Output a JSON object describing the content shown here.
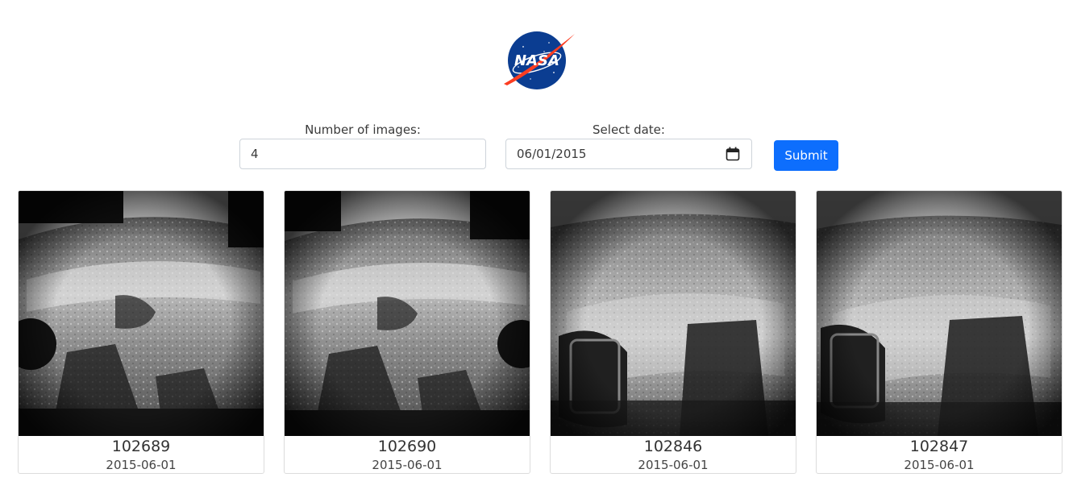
{
  "logo": {
    "label": "NASA",
    "icon": "nasa-meatball-logo"
  },
  "form": {
    "count_label": "Number of images:",
    "count_value": "4",
    "date_label": "Select date:",
    "date_value": "06/01/2015",
    "submit_label": "Submit",
    "calendar_icon": "calendar-icon"
  },
  "colors": {
    "accent": "#0d6efd",
    "nasa_blue": "#0b3d91",
    "nasa_red": "#fc3d21"
  },
  "images": [
    {
      "id": "102689",
      "date": "2015-06-01"
    },
    {
      "id": "102690",
      "date": "2015-06-01"
    },
    {
      "id": "102846",
      "date": "2015-06-01"
    },
    {
      "id": "102847",
      "date": "2015-06-01"
    }
  ]
}
